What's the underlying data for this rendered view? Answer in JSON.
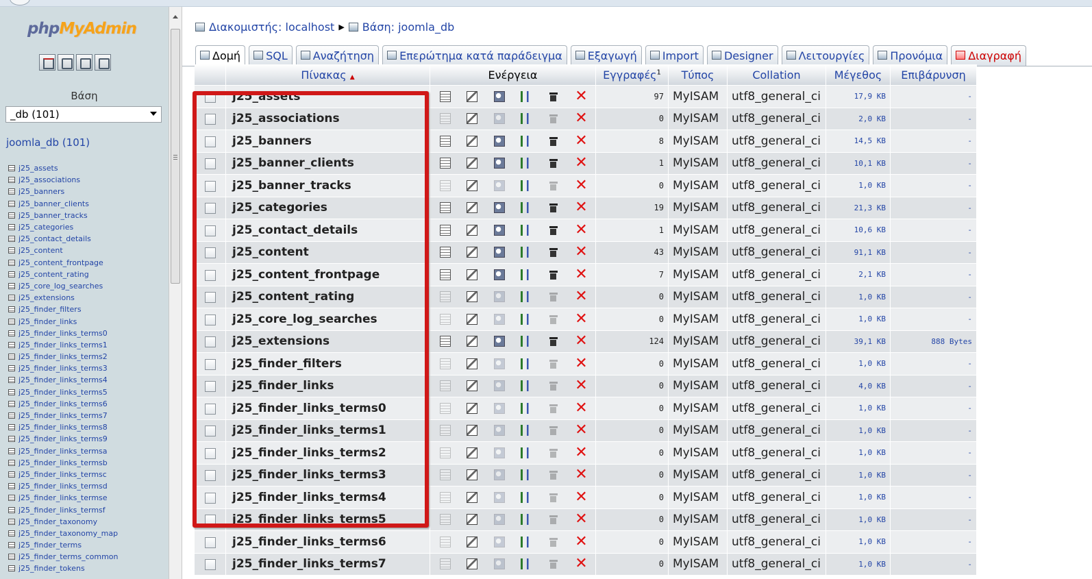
{
  "nav": {
    "logo_php": "php",
    "logo_myadmin": "MyAdmin",
    "quick_icons": [
      "home-icon",
      "sql-query-icon",
      "docs-icon",
      "docs-icon"
    ],
    "db_label": "Βάση",
    "db_select_value": "_db (101)",
    "db_link": "joomla_db",
    "db_count": "(101)",
    "tables": [
      "j25_assets",
      "j25_associations",
      "j25_banners",
      "j25_banner_clients",
      "j25_banner_tracks",
      "j25_categories",
      "j25_contact_details",
      "j25_content",
      "j25_content_frontpage",
      "j25_content_rating",
      "j25_core_log_searches",
      "j25_extensions",
      "j25_finder_filters",
      "j25_finder_links",
      "j25_finder_links_terms0",
      "j25_finder_links_terms1",
      "j25_finder_links_terms2",
      "j25_finder_links_terms3",
      "j25_finder_links_terms4",
      "j25_finder_links_terms5",
      "j25_finder_links_terms6",
      "j25_finder_links_terms7",
      "j25_finder_links_terms8",
      "j25_finder_links_terms9",
      "j25_finder_links_termsa",
      "j25_finder_links_termsb",
      "j25_finder_links_termsc",
      "j25_finder_links_termsd",
      "j25_finder_links_termse",
      "j25_finder_links_termsf",
      "j25_finder_taxonomy",
      "j25_finder_taxonomy_map",
      "j25_finder_terms",
      "j25_finder_terms_common",
      "j25_finder_tokens"
    ]
  },
  "breadcrumb": {
    "server": "Διακομιστής: localhost",
    "separator": "▶",
    "database": "Βάση: joomla_db"
  },
  "tabs": [
    {
      "label": "Δομή",
      "icon": "structure-icon",
      "active": true
    },
    {
      "label": "SQL",
      "icon": "sql-icon"
    },
    {
      "label": "Αναζήτηση",
      "icon": "search-icon"
    },
    {
      "label": "Επερώτημα κατά παράδειγμα",
      "icon": "query-icon"
    },
    {
      "label": "Εξαγωγή",
      "icon": "export-icon"
    },
    {
      "label": "Import",
      "icon": "import-icon"
    },
    {
      "label": "Designer",
      "icon": "designer-icon"
    },
    {
      "label": "Λειτουργίες",
      "icon": "operations-icon"
    },
    {
      "label": "Προνόμια",
      "icon": "privileges-icon"
    },
    {
      "label": "Διαγραφή",
      "icon": "drop-icon",
      "danger": true
    }
  ],
  "table": {
    "headers": {
      "name": "Πίνακας",
      "sort_arrow": "▲",
      "action": "Ενέργεια",
      "rows": "Εγγραφές",
      "rows_sup": "1",
      "type": "Τύπος",
      "collation": "Collation",
      "size": "Μέγεθος",
      "overhead": "Επιβάρυνση"
    },
    "rows": [
      {
        "name": "j25_assets",
        "records": "97",
        "type": "MyISAM",
        "collation": "utf8_general_ci",
        "size": "17,9 KB",
        "overhead": "-",
        "empty": false
      },
      {
        "name": "j25_associations",
        "records": "0",
        "type": "MyISAM",
        "collation": "utf8_general_ci",
        "size": "2,0 KB",
        "overhead": "-",
        "empty": true
      },
      {
        "name": "j25_banners",
        "records": "8",
        "type": "MyISAM",
        "collation": "utf8_general_ci",
        "size": "14,5 KB",
        "overhead": "-",
        "empty": false
      },
      {
        "name": "j25_banner_clients",
        "records": "1",
        "type": "MyISAM",
        "collation": "utf8_general_ci",
        "size": "10,1 KB",
        "overhead": "-",
        "empty": false
      },
      {
        "name": "j25_banner_tracks",
        "records": "0",
        "type": "MyISAM",
        "collation": "utf8_general_ci",
        "size": "1,0 KB",
        "overhead": "-",
        "empty": true
      },
      {
        "name": "j25_categories",
        "records": "19",
        "type": "MyISAM",
        "collation": "utf8_general_ci",
        "size": "21,3 KB",
        "overhead": "-",
        "empty": false
      },
      {
        "name": "j25_contact_details",
        "records": "1",
        "type": "MyISAM",
        "collation": "utf8_general_ci",
        "size": "10,6 KB",
        "overhead": "-",
        "empty": false
      },
      {
        "name": "j25_content",
        "records": "43",
        "type": "MyISAM",
        "collation": "utf8_general_ci",
        "size": "91,1 KB",
        "overhead": "-",
        "empty": false
      },
      {
        "name": "j25_content_frontpage",
        "records": "7",
        "type": "MyISAM",
        "collation": "utf8_general_ci",
        "size": "2,1 KB",
        "overhead": "-",
        "empty": false
      },
      {
        "name": "j25_content_rating",
        "records": "0",
        "type": "MyISAM",
        "collation": "utf8_general_ci",
        "size": "1,0 KB",
        "overhead": "-",
        "empty": true
      },
      {
        "name": "j25_core_log_searches",
        "records": "0",
        "type": "MyISAM",
        "collation": "utf8_general_ci",
        "size": "1,0 KB",
        "overhead": "-",
        "empty": true
      },
      {
        "name": "j25_extensions",
        "records": "124",
        "type": "MyISAM",
        "collation": "utf8_general_ci",
        "size": "39,1 KB",
        "overhead": "888 Bytes",
        "empty": false
      },
      {
        "name": "j25_finder_filters",
        "records": "0",
        "type": "MyISAM",
        "collation": "utf8_general_ci",
        "size": "1,0 KB",
        "overhead": "-",
        "empty": true
      },
      {
        "name": "j25_finder_links",
        "records": "0",
        "type": "MyISAM",
        "collation": "utf8_general_ci",
        "size": "4,0 KB",
        "overhead": "-",
        "empty": true
      },
      {
        "name": "j25_finder_links_terms0",
        "records": "0",
        "type": "MyISAM",
        "collation": "utf8_general_ci",
        "size": "1,0 KB",
        "overhead": "-",
        "empty": true
      },
      {
        "name": "j25_finder_links_terms1",
        "records": "0",
        "type": "MyISAM",
        "collation": "utf8_general_ci",
        "size": "1,0 KB",
        "overhead": "-",
        "empty": true
      },
      {
        "name": "j25_finder_links_terms2",
        "records": "0",
        "type": "MyISAM",
        "collation": "utf8_general_ci",
        "size": "1,0 KB",
        "overhead": "-",
        "empty": true
      },
      {
        "name": "j25_finder_links_terms3",
        "records": "0",
        "type": "MyISAM",
        "collation": "utf8_general_ci",
        "size": "1,0 KB",
        "overhead": "-",
        "empty": true
      },
      {
        "name": "j25_finder_links_terms4",
        "records": "0",
        "type": "MyISAM",
        "collation": "utf8_general_ci",
        "size": "1,0 KB",
        "overhead": "-",
        "empty": true
      },
      {
        "name": "j25_finder_links_terms5",
        "records": "0",
        "type": "MyISAM",
        "collation": "utf8_general_ci",
        "size": "1,0 KB",
        "overhead": "-",
        "empty": true
      },
      {
        "name": "j25_finder_links_terms6",
        "records": "0",
        "type": "MyISAM",
        "collation": "utf8_general_ci",
        "size": "1,0 KB",
        "overhead": "-",
        "empty": true
      },
      {
        "name": "j25_finder_links_terms7",
        "records": "0",
        "type": "MyISAM",
        "collation": "utf8_general_ci",
        "size": "1,0 KB",
        "overhead": "-",
        "empty": true
      }
    ]
  },
  "colors": {
    "link": "#2345a6",
    "highlight_box": "#d01818",
    "drop_x": "#e01010",
    "nav_bg": "#d0dce0"
  }
}
